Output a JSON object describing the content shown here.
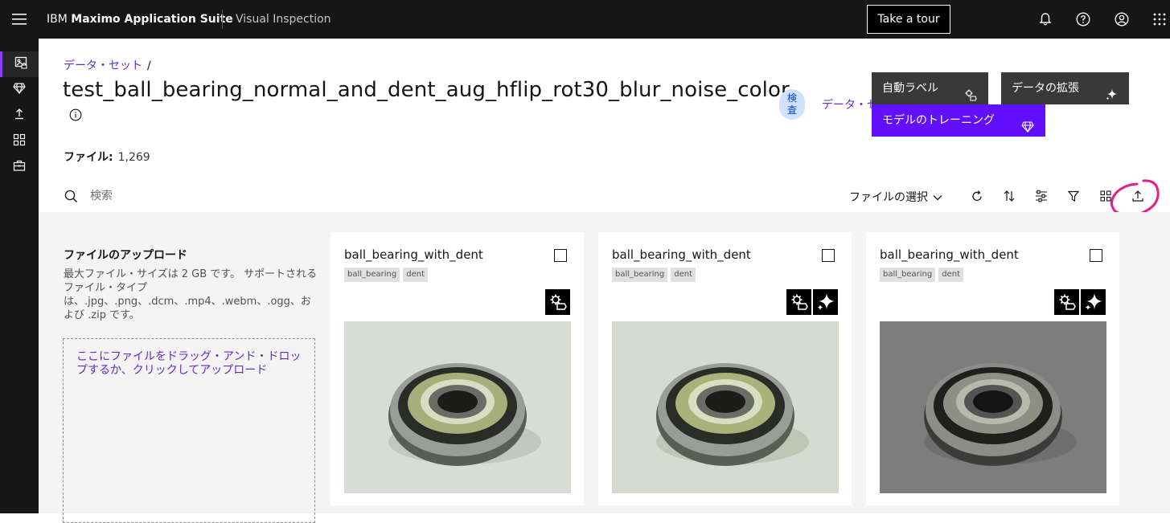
{
  "header": {
    "brand_prefix": "IBM",
    "brand_name": "Maximo Application Suite",
    "product": "Visual Inspection",
    "tour_label": "Take a tour",
    "icons": [
      "notification-icon",
      "help-icon",
      "user-icon",
      "app-switcher-icon"
    ]
  },
  "rail": {
    "items": [
      "datasets-icon",
      "models-icon",
      "deploy-icon",
      "projects-icon",
      "toolkit-icon"
    ],
    "active": "datasets-icon"
  },
  "breadcrumb": {
    "link": "データ・セット",
    "separator": "/"
  },
  "page": {
    "title": "test_ball_bearing_normal_and_dent_aug_hflip_rot30_blur_noise_color",
    "tag": "検査",
    "data_link": "データ・セ"
  },
  "actions": {
    "auto_label": "自動ラベル",
    "augment": "データの拡張",
    "train": "モデルのトレーニング"
  },
  "files": {
    "label": "ファイル:",
    "count": "1,269"
  },
  "toolbar": {
    "search_placeholder": "検索",
    "file_select": "ファイルの選択",
    "icons": [
      "refresh-icon",
      "sort-icon",
      "settings-adjust-icon",
      "filter-icon",
      "grid-view-icon",
      "upload-icon"
    ]
  },
  "upload": {
    "title": "ファイルのアップロード",
    "description": "最大ファイル・サイズは 2 GB です。 サポートされるファイル・タイプは、.jpg、.png、.dcm、.mp4、.webm、.ogg、および .zip です。",
    "dropzone": "ここにファイルをドラッグ・アンド・ドロップするか、クリックしてアップロード"
  },
  "cards": [
    {
      "name": "ball_bearing_with_dent",
      "tags": [
        "ball_bearing",
        "dent"
      ],
      "badges": [
        "auto-label-icon"
      ],
      "bg": "#d9dcd5"
    },
    {
      "name": "ball_bearing_with_dent",
      "tags": [
        "ball_bearing",
        "dent"
      ],
      "badges": [
        "auto-label-icon",
        "augment-icon"
      ],
      "bg": "#d6dad0"
    },
    {
      "name": "ball_bearing_with_dent",
      "tags": [
        "ball_bearing",
        "dent"
      ],
      "badges": [
        "auto-label-icon",
        "augment-icon"
      ],
      "bg": "#7d7d7d"
    }
  ],
  "colors": {
    "accent": "#620ffc",
    "link": "#6929c4",
    "annotation": "#e0218a"
  }
}
